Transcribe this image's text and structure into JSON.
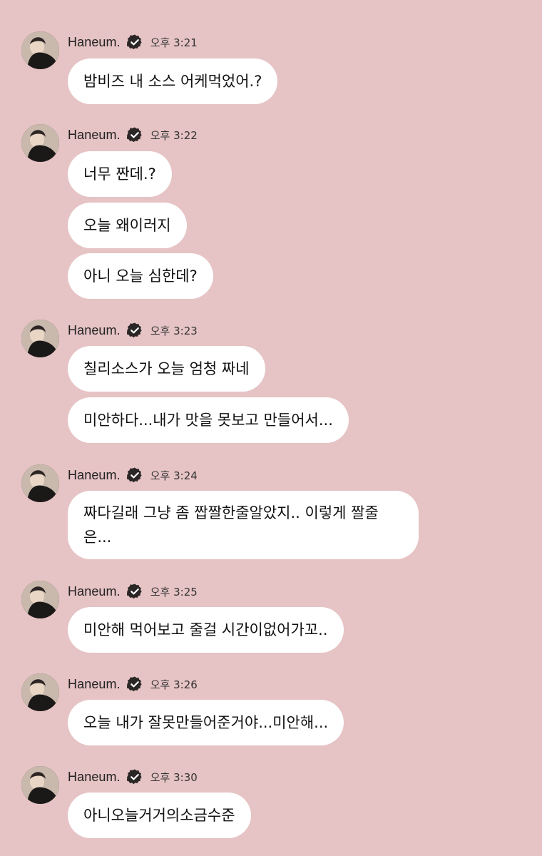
{
  "groups": [
    {
      "sender": "Haneum.",
      "time": "오후 3:21",
      "messages": [
        "밤비즈 내 소스 어케먹었어.?"
      ]
    },
    {
      "sender": "Haneum.",
      "time": "오후 3:22",
      "messages": [
        "너무 짠데.?",
        "오늘 왜이러지",
        "아니 오늘 심한데?"
      ]
    },
    {
      "sender": "Haneum.",
      "time": "오후 3:23",
      "messages": [
        "칠리소스가 오늘 엄청 짜네",
        "미안하다...내가 맛을 못보고 만들어서..."
      ]
    },
    {
      "sender": "Haneum.",
      "time": "오후 3:24",
      "messages": [
        "짜다길래 그냥 좀 짭짤한줄알았지.. 이렇게 짤줄은..."
      ]
    },
    {
      "sender": "Haneum.",
      "time": "오후 3:25",
      "messages": [
        "미안해 먹어보고 줄걸 시간이없어가꼬.."
      ]
    },
    {
      "sender": "Haneum.",
      "time": "오후 3:26",
      "messages": [
        "오늘 내가 잘못만들어준거야...미안해..."
      ]
    },
    {
      "sender": "Haneum.",
      "time": "오후 3:30",
      "messages": [
        "아니오늘거거의소금수준"
      ]
    }
  ],
  "icons": {
    "verified": "verified-badge-icon",
    "avatar": "profile-avatar"
  },
  "colors": {
    "background": "#e6c3c4",
    "bubble": "#ffffff",
    "text": "#111111"
  }
}
